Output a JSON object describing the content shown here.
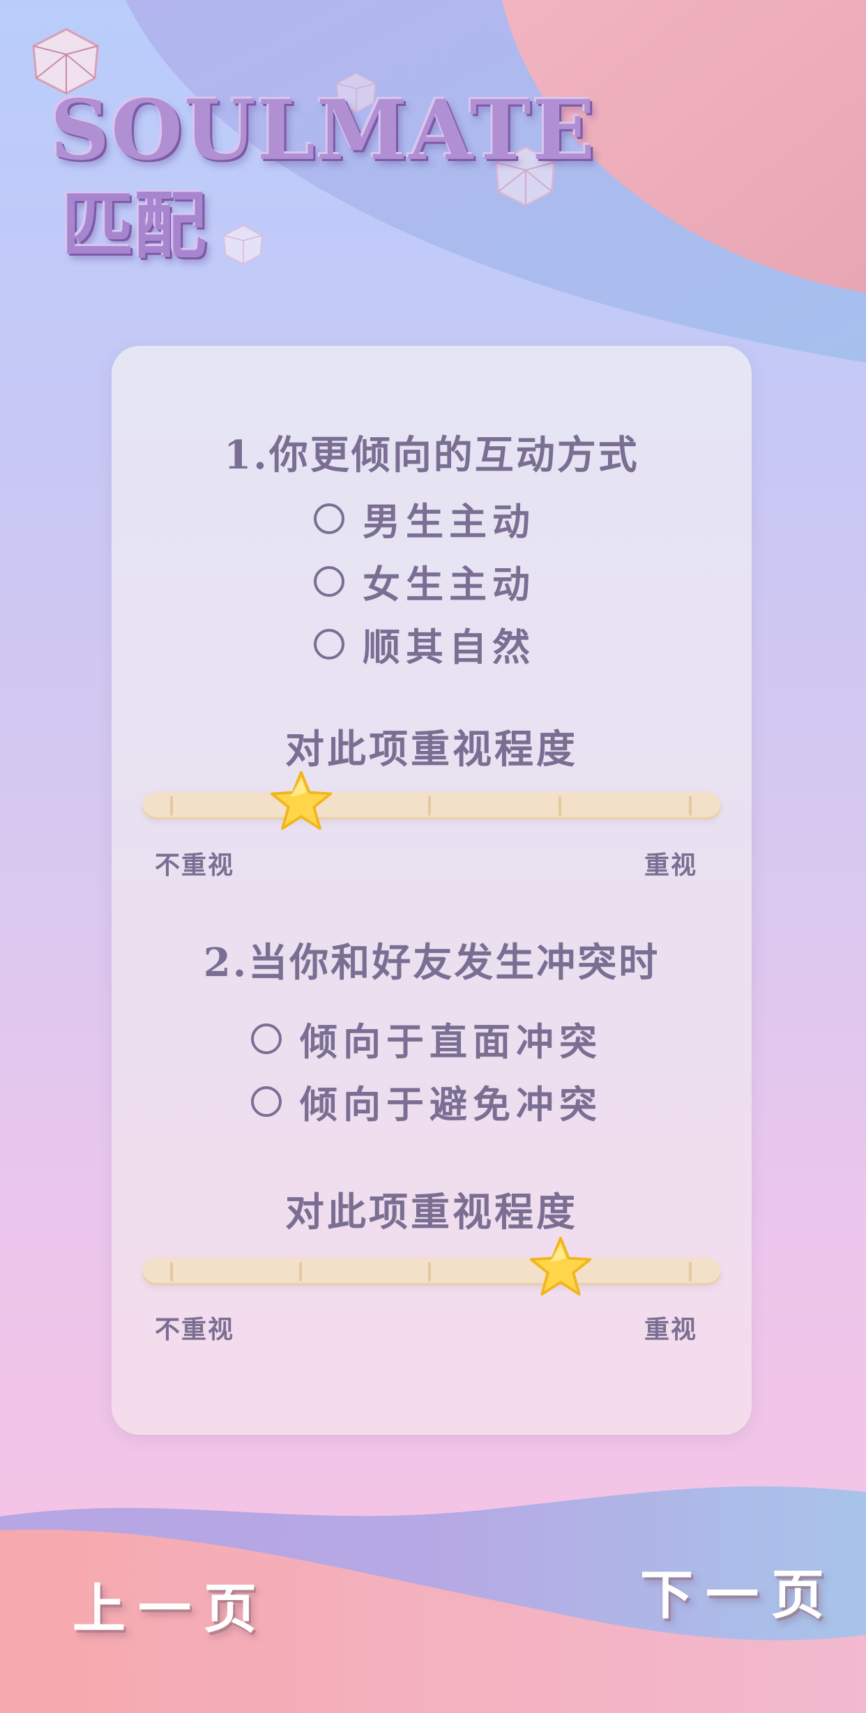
{
  "logo": {
    "title": "SOULMATE",
    "subtitle": "匹配"
  },
  "questions": [
    {
      "title": "1.你更倾向的互动方式",
      "options": [
        "男生主动",
        "女生主动",
        "顺其自然"
      ],
      "importance_label": "对此项重视程度",
      "scale_min_label": "不重视",
      "scale_max_label": "重视",
      "importance_level": 0.25
    },
    {
      "title": "2.当你和好友发生冲突时",
      "options": [
        "倾向于直面冲突",
        "倾向于避免冲突"
      ],
      "importance_label": "对此项重视程度",
      "scale_min_label": "不重视",
      "scale_max_label": "重视",
      "importance_level": 0.75
    }
  ],
  "nav": {
    "prev_label": "上一页",
    "next_label": "下一页"
  },
  "colors": {
    "text": "#7a6e93",
    "slider": "#f3e0c8",
    "star": "#ffd64a",
    "logo": "#b08fd2"
  }
}
